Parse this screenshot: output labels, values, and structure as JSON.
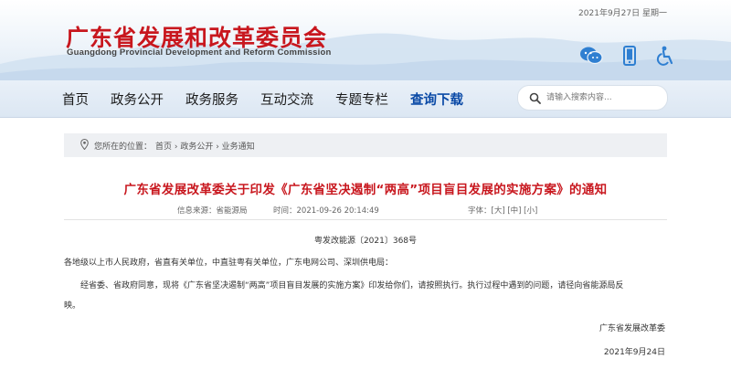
{
  "header": {
    "date": "2021年9月27日  星期一",
    "title_cn": "广东省发展和改革委员会",
    "title_en": "Guangdong Provincial Development and Reform Commission",
    "tool_icons": [
      "wechat-icon",
      "mobile-icon",
      "accessibility-icon"
    ]
  },
  "nav": {
    "items": [
      {
        "label": "首页"
      },
      {
        "label": "政务公开"
      },
      {
        "label": "政务服务"
      },
      {
        "label": "互动交流"
      },
      {
        "label": "专题专栏"
      },
      {
        "label": "查询下载"
      }
    ],
    "active_index": 5
  },
  "search": {
    "placeholder": "请输入搜索内容..."
  },
  "breadcrumb": {
    "prefix": "您所在的位置：",
    "path": "首页 › 政务公开 › 业务通知"
  },
  "article": {
    "title": "广东省发展改革委关于印发《广东省坚决遏制“两高”项目盲目发展的实施方案》的通知",
    "source_label": "信息来源：省能源局",
    "time_label": "时间：2021-09-26 20:14:49",
    "font_size_label": "字体：[大] [中] [小]",
    "doc_no": "粤发改能源〔2021〕368号",
    "salutation": "各地级以上市人民政府，省直有关单位，中直驻粤有关单位，广东电网公司、深圳供电局：",
    "body_line1": "经省委、省政府同意，现将《广东省坚决遏制“两高”项目盲目发展的实施方案》印发给你们，请按照执行。执行过程中遇到的问题，请径向省能源局反",
    "body_line2": "映。",
    "signature": "广东省发展改革委",
    "sign_date": "2021年9月24日"
  },
  "colors": {
    "brand_red": "#c8171e",
    "nav_active": "#0b4aa6",
    "icon_blue": "#2f7fd1"
  }
}
